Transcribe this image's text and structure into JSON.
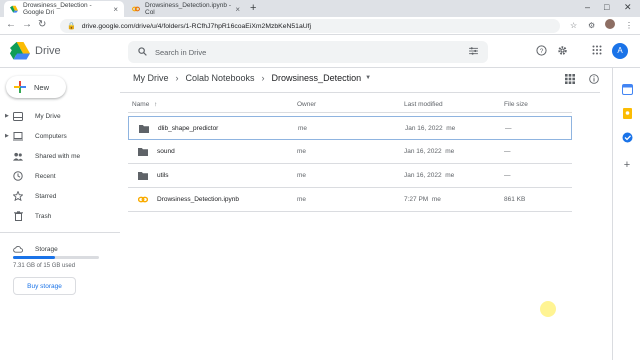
{
  "browser": {
    "tabs": [
      {
        "title": "Drowsiness_Detection - Google Dri",
        "active": true
      },
      {
        "title": "Drowsiness_Detection.ipynb - Col",
        "active": false
      }
    ],
    "url": "drive.google.com/drive/u/4/folders/1-RCfhJ7hpR16coaEiXm2MzbKeN51aUfj"
  },
  "app": {
    "name": "Drive",
    "search_placeholder": "Search in Drive",
    "avatar_letter": "A",
    "new_label": "New"
  },
  "sidebar": {
    "items": [
      {
        "label": "My Drive",
        "icon": "my-drive-icon"
      },
      {
        "label": "Computers",
        "icon": "computer-icon"
      },
      {
        "label": "Shared with me",
        "icon": "shared-icon"
      },
      {
        "label": "Recent",
        "icon": "clock-icon"
      },
      {
        "label": "Starred",
        "icon": "star-icon"
      },
      {
        "label": "Trash",
        "icon": "trash-icon"
      }
    ],
    "storage_label": "Storage",
    "storage_used_fraction": 0.49,
    "storage_text": "7.31 GB of 15 GB used",
    "buy_label": "Buy storage"
  },
  "breadcrumb": {
    "items": [
      "My Drive",
      "Colab Notebooks",
      "Drowsiness_Detection"
    ]
  },
  "columns": {
    "name": "Name",
    "owner": "Owner",
    "modified": "Last modified",
    "size": "File size"
  },
  "files": [
    {
      "name": "dlib_shape_predictor",
      "owner": "me",
      "modified": "Jan 16, 2022",
      "modified_by": "me",
      "size": "—",
      "type": "folder"
    },
    {
      "name": "sound",
      "owner": "me",
      "modified": "Jan 16, 2022",
      "modified_by": "me",
      "size": "—",
      "type": "folder"
    },
    {
      "name": "utils",
      "owner": "me",
      "modified": "Jan 16, 2022",
      "modified_by": "me",
      "size": "—",
      "type": "folder"
    },
    {
      "name": "Drowsiness_Detection.ipynb",
      "owner": "me",
      "modified": "7:27 PM",
      "modified_by": "me",
      "size": "861 KB",
      "type": "colab"
    }
  ],
  "colors": {
    "accent": "#1a73e8",
    "folder": "#5f6368",
    "colab": "#f9ab00"
  }
}
